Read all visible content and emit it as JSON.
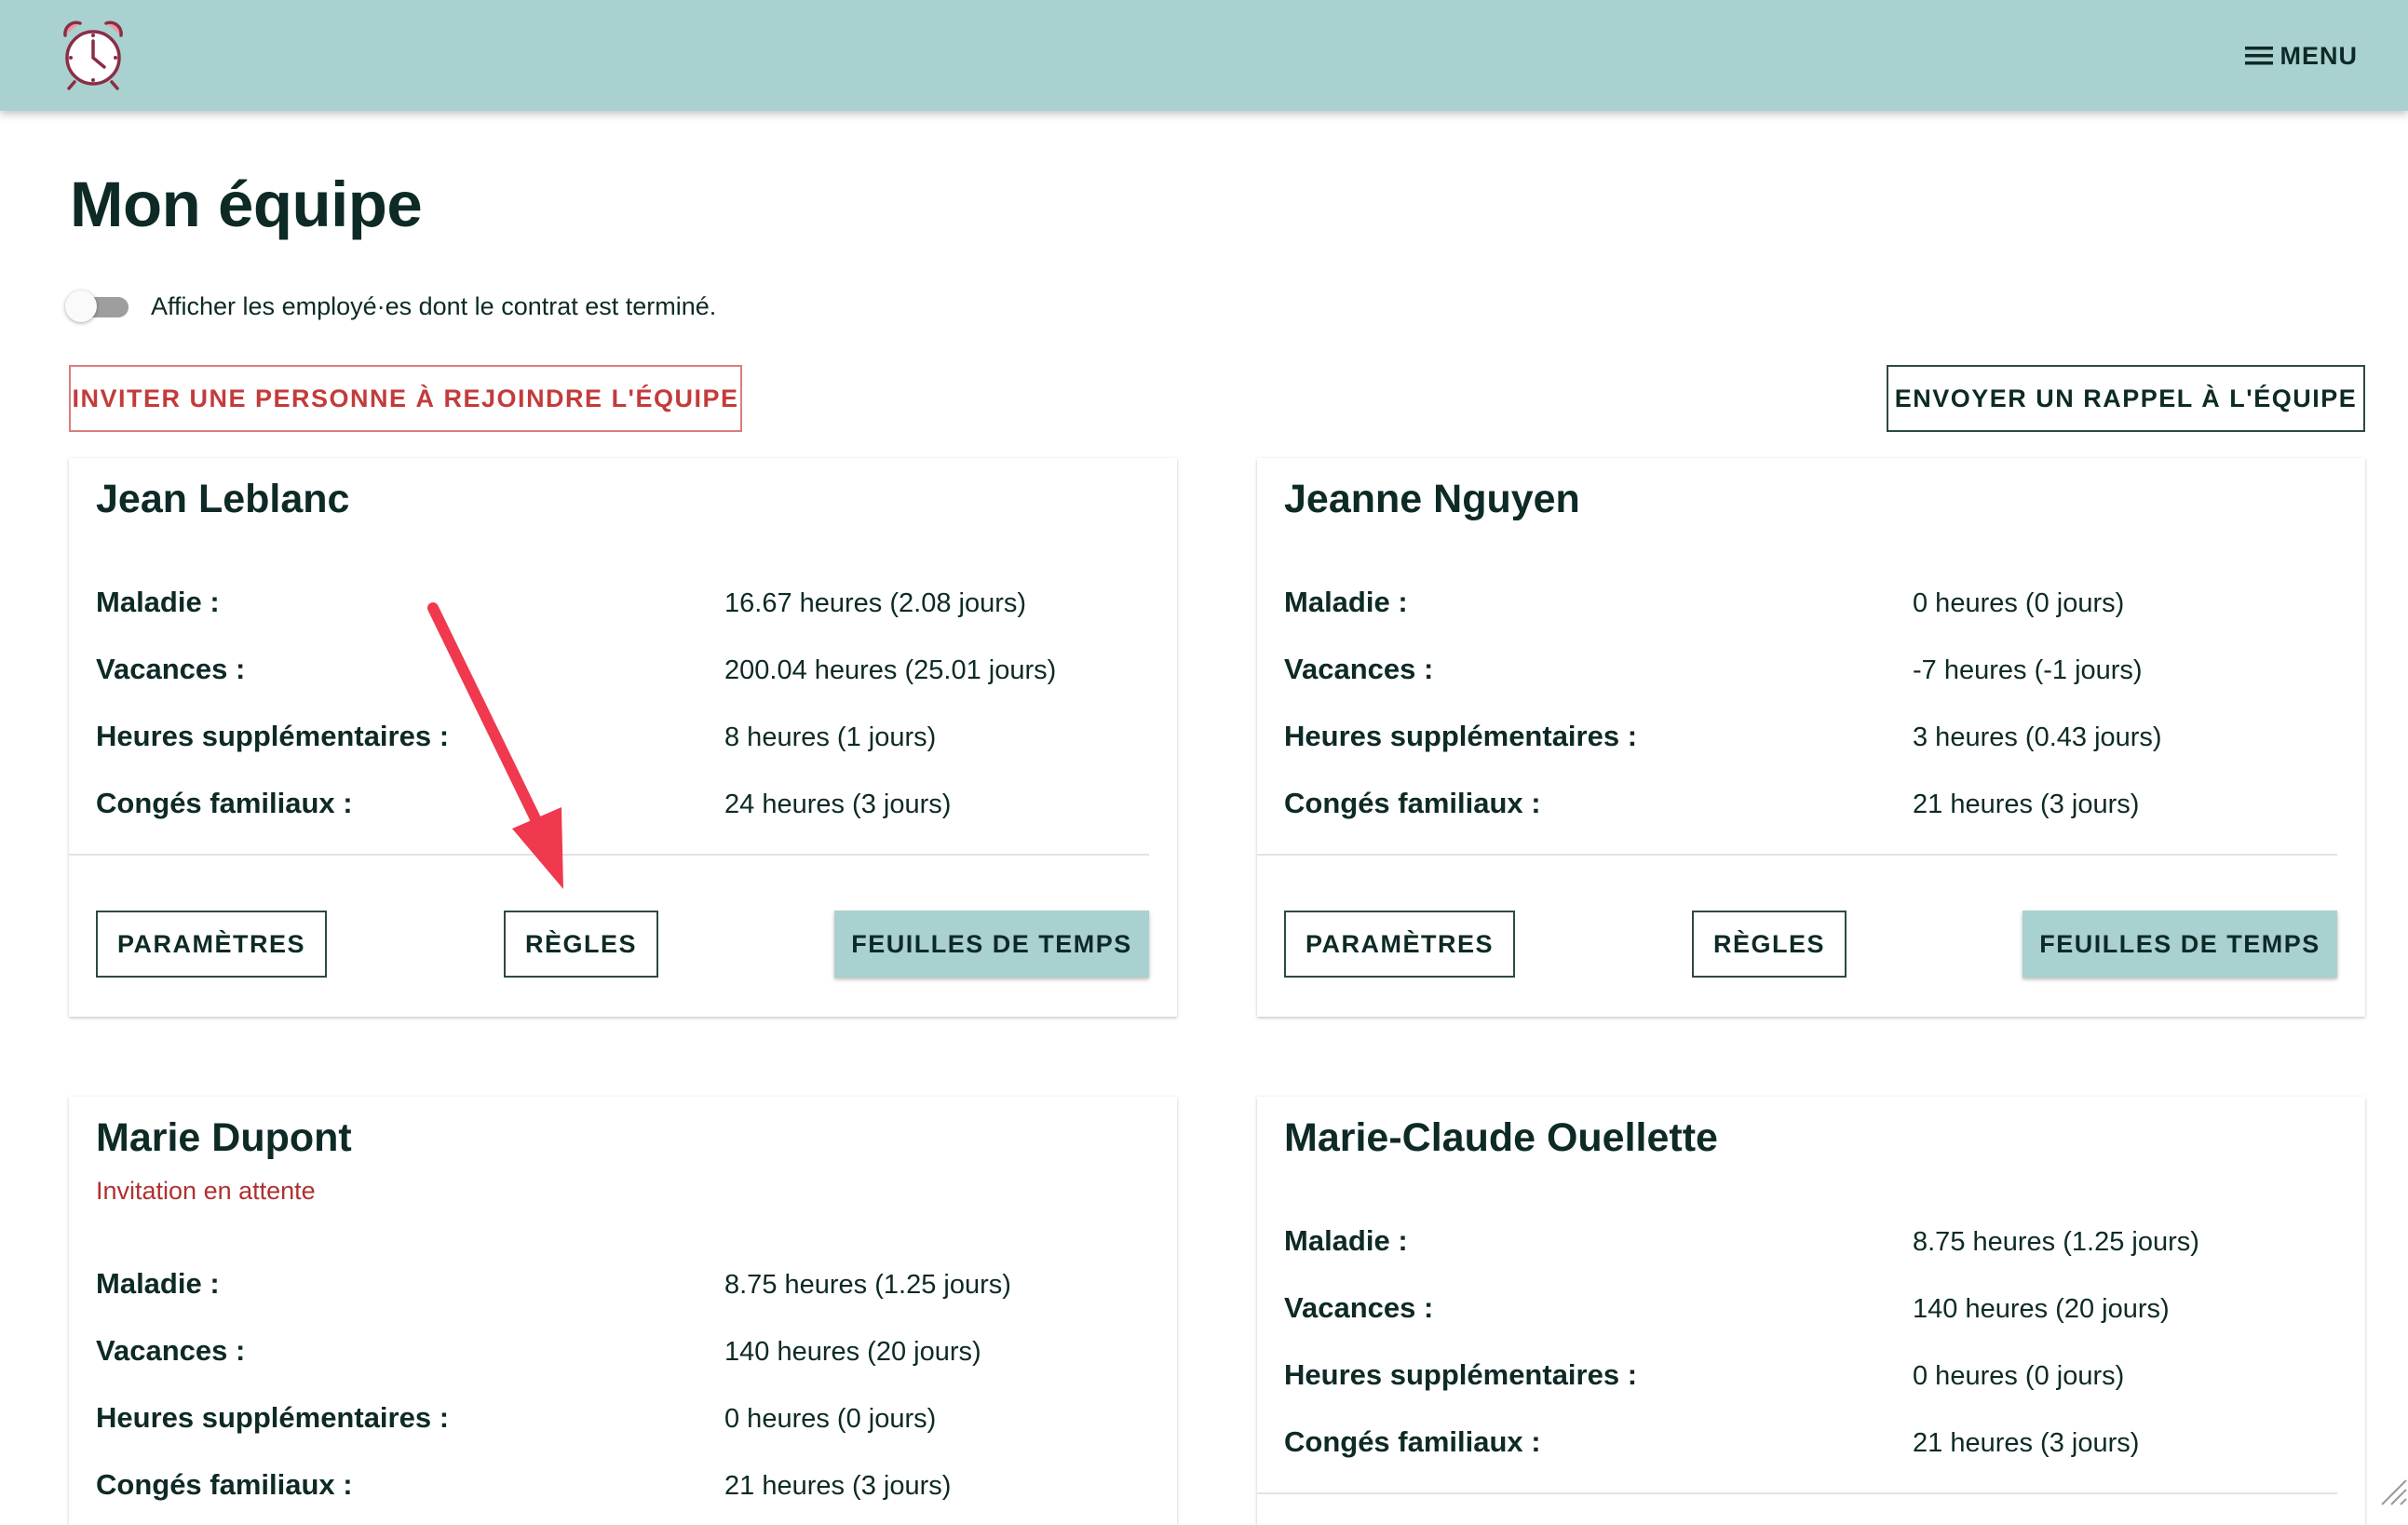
{
  "header": {
    "logo_icon": "alarm-clock-icon",
    "menu_label": "MENU",
    "menu_icon": "hamburger-icon"
  },
  "page": {
    "title": "Mon équipe",
    "toggle_label": "Afficher les employé·es dont le contrat est terminé.",
    "toggle_on": false
  },
  "actions": {
    "invite_label": "INVITER UNE PERSONNE À REJOINDRE L'ÉQUIPE",
    "remind_label": "ENVOYER UN RAPPEL À L'ÉQUIPE"
  },
  "labels": {
    "sick": "Maladie :",
    "vacation": "Vacances :",
    "overtime": "Heures supplémentaires :",
    "family": "Congés familiaux :"
  },
  "buttons": {
    "settings": "PARAMÈTRES",
    "rules": "RÈGLES",
    "timesheets": "FEUILLES DE TEMPS"
  },
  "employees": [
    {
      "name": "Jean Leblanc",
      "status": "",
      "sick": "16.67 heures (2.08 jours)",
      "vacation": "200.04 heures (25.01 jours)",
      "overtime": "8 heures (1 jours)",
      "family": "24 heures (3 jours)"
    },
    {
      "name": "Jeanne Nguyen",
      "status": "",
      "sick": "0 heures (0 jours)",
      "vacation": "-7 heures (-1 jours)",
      "overtime": "3 heures (0.43 jours)",
      "family": "21 heures (3 jours)"
    },
    {
      "name": "Marie Dupont",
      "status": "Invitation en attente",
      "sick": "8.75 heures (1.25 jours)",
      "vacation": "140 heures (20 jours)",
      "overtime": "0 heures (0 jours)",
      "family": "21 heures (3 jours)"
    },
    {
      "name": "Marie-Claude Ouellette",
      "status": "",
      "sick": "8.75 heures (1.25 jours)",
      "vacation": "140 heures (20 jours)",
      "overtime": "0 heures (0 jours)",
      "family": "21 heures (3 jours)"
    }
  ],
  "colors": {
    "header_bg": "#a9d1cf",
    "invite_red": "#c33b3b",
    "annotation_arrow": "#f0394f",
    "text_dark": "#0d2a26"
  }
}
